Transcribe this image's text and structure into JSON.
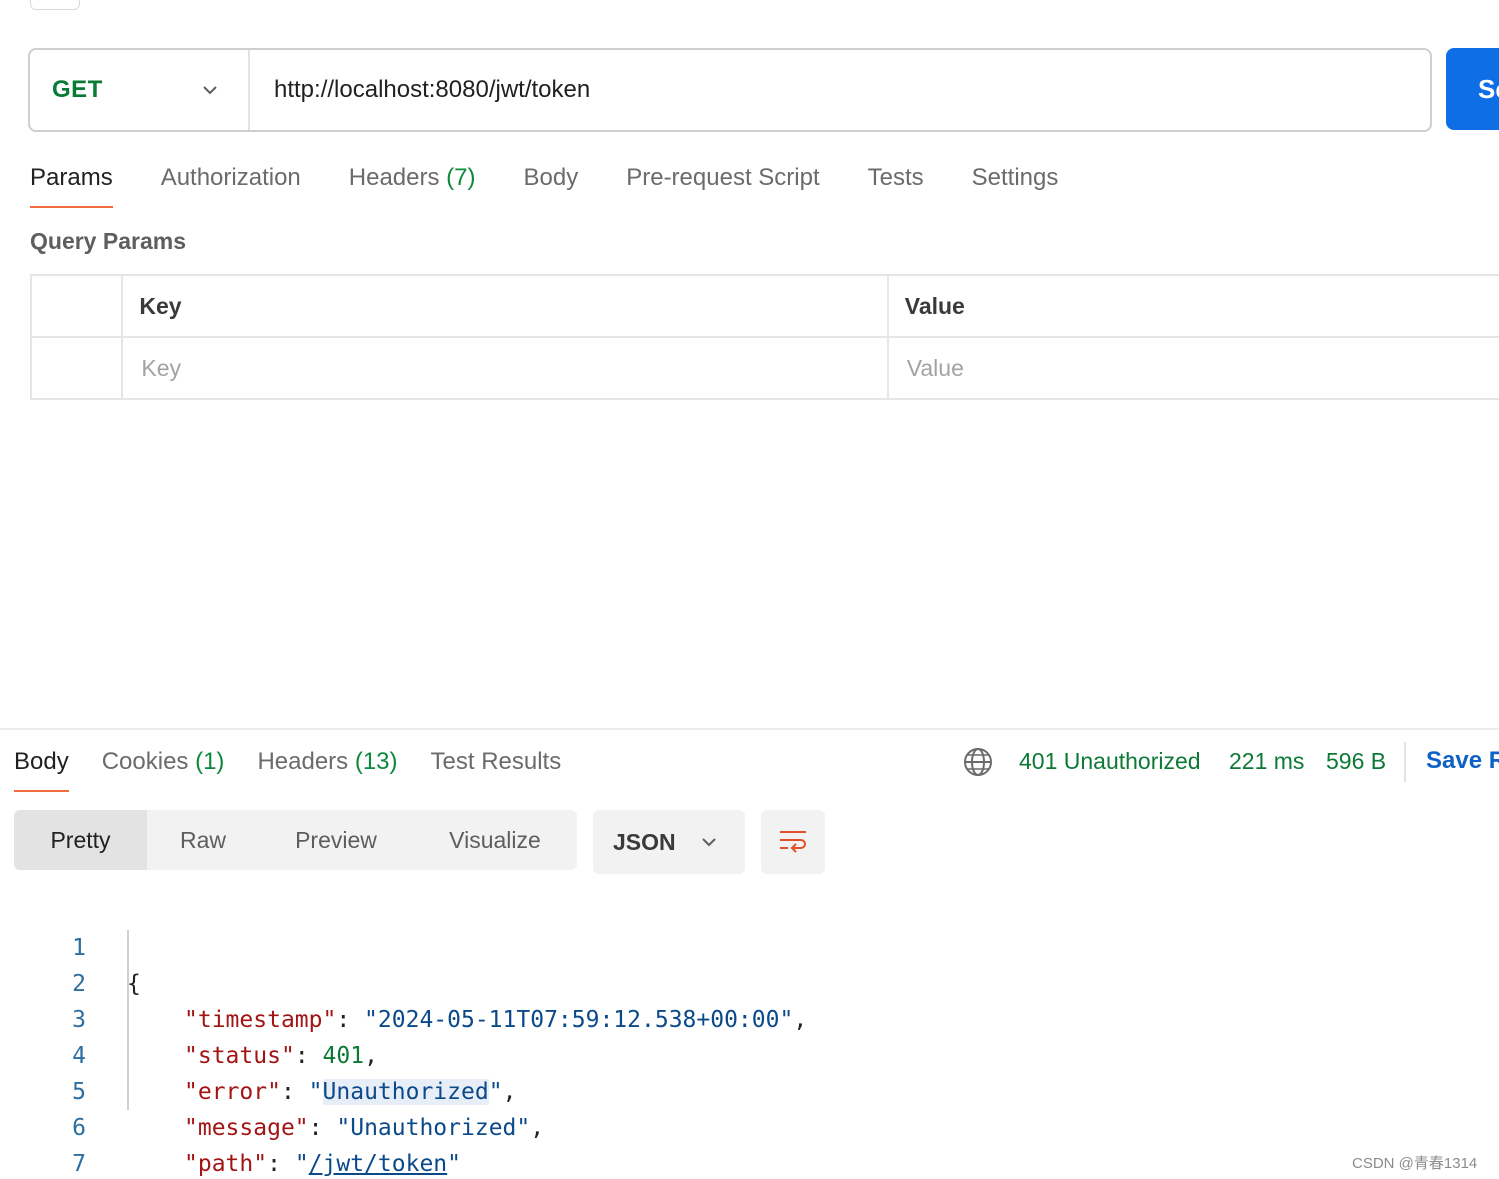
{
  "request": {
    "method": "GET",
    "url": "http://localhost:8080/jwt/token",
    "send_label": "Se"
  },
  "request_tabs": [
    {
      "label": "Params",
      "count": ""
    },
    {
      "label": "Authorization",
      "count": ""
    },
    {
      "label": "Headers",
      "count": "(7)"
    },
    {
      "label": "Body",
      "count": ""
    },
    {
      "label": "Pre-request Script",
      "count": ""
    },
    {
      "label": "Tests",
      "count": ""
    },
    {
      "label": "Settings",
      "count": ""
    }
  ],
  "query_params": {
    "title": "Query Params",
    "key_header": "Key",
    "value_header": "Value",
    "key_placeholder": "Key",
    "value_placeholder": "Value"
  },
  "response_tabs": [
    {
      "label": "Body",
      "count": ""
    },
    {
      "label": "Cookies",
      "count": "(1)"
    },
    {
      "label": "Headers",
      "count": "(13)"
    },
    {
      "label": "Test Results",
      "count": ""
    }
  ],
  "response_meta": {
    "status": "401 Unauthorized",
    "time": "221 ms",
    "size": "596 B",
    "save_label": "Save R"
  },
  "views": [
    "Pretty",
    "Raw",
    "Preview",
    "Visualize"
  ],
  "format": "JSON",
  "code": {
    "line_numbers": [
      "1",
      "2",
      "3",
      "4",
      "5",
      "6",
      "7"
    ],
    "open_brace": "{",
    "close_brace": "}",
    "fields": [
      {
        "key": "timestamp",
        "value": "2024-05-11T07:59:12.538+00:00"
      },
      {
        "key": "status",
        "value": "401"
      },
      {
        "key": "error",
        "value": "Unauthorized"
      },
      {
        "key": "message",
        "value": "Unauthorized"
      },
      {
        "key": "path",
        "value": "/jwt/token"
      }
    ]
  },
  "watermark": "CSDN @青春1314",
  "colors": {
    "accent_tab": "#f26b3a",
    "send_button": "#0e6ee6",
    "status_green": "#0c7a35",
    "json_key": "#a31515",
    "json_string": "#0b4a8a"
  }
}
